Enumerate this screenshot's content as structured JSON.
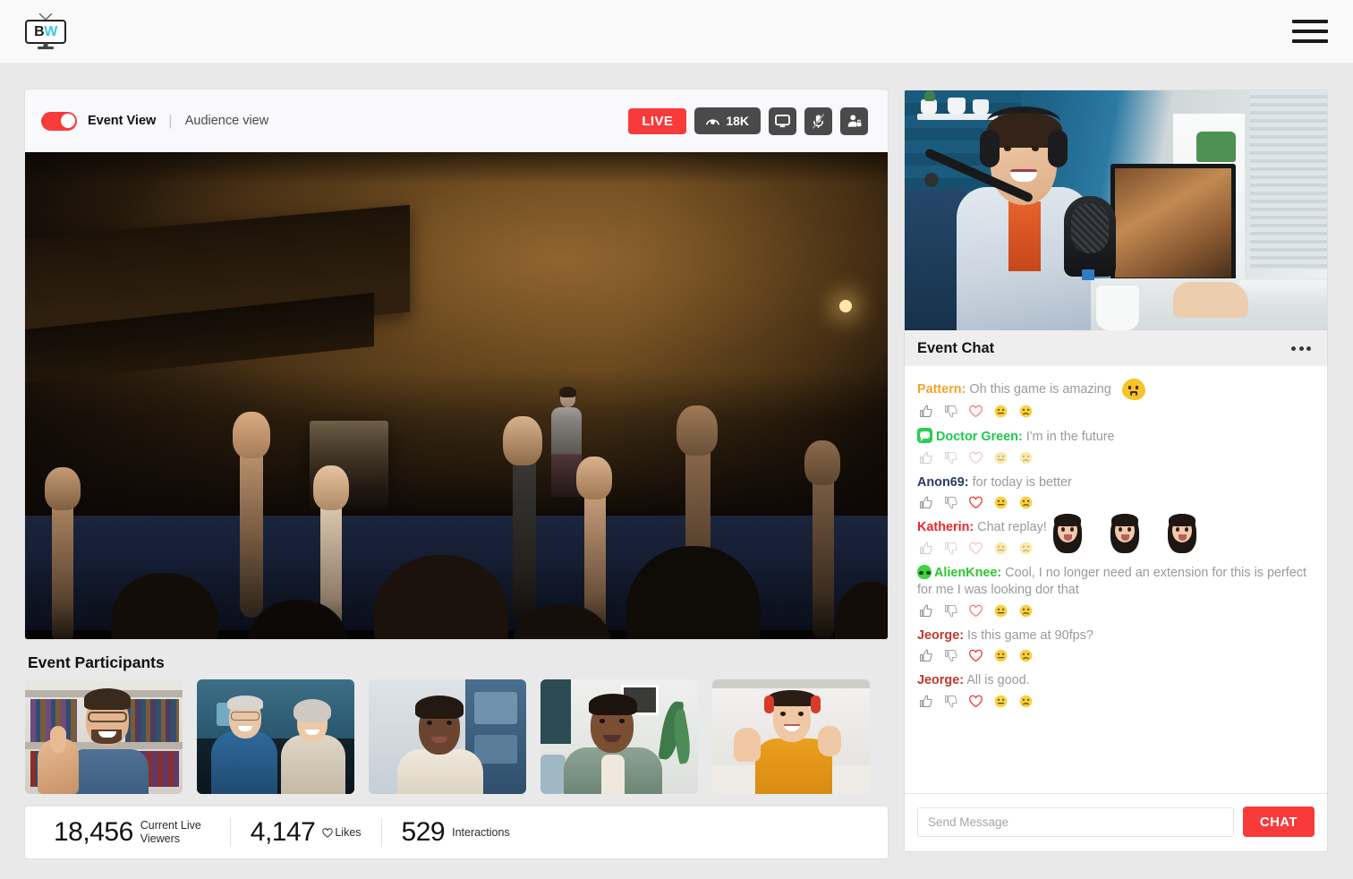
{
  "brand": {
    "logo_text_1": "B",
    "logo_text_2": "W",
    "logo_name": "BW"
  },
  "topbar": {
    "menu_label": "Menu"
  },
  "event_header": {
    "toggle_state": "on",
    "primary_label": "Event View",
    "separator": "|",
    "secondary_label": "Audience view",
    "live_label": "LIVE",
    "viewer_count": "18K",
    "viewer_icon": "eye-icon",
    "screen_icon": "monitor-icon",
    "mic_icon": "mic-muted-icon",
    "privacy_icon": "user-lock-icon"
  },
  "participants": {
    "title": "Event Participants",
    "items": [
      {
        "name": "participant-1",
        "desc": "Man with glasses giving thumbs up"
      },
      {
        "name": "participant-2",
        "desc": "Older couple smiling"
      },
      {
        "name": "participant-3",
        "desc": "Woman in cream top"
      },
      {
        "name": "participant-4",
        "desc": "Man in green shirt"
      },
      {
        "name": "participant-5",
        "desc": "Woman in orange top waving"
      }
    ]
  },
  "stats": [
    {
      "value": "18,456",
      "label": "Current Live Viewers",
      "icon": ""
    },
    {
      "value": "4,147",
      "label": "Likes",
      "icon": "heart-icon"
    },
    {
      "value": "529",
      "label": "Interactions",
      "icon": ""
    }
  ],
  "chat": {
    "title": "Event Chat",
    "menu_icon": "more-options-icon",
    "input_placeholder": "Send Message",
    "input_value": "",
    "send_label": "CHAT",
    "reaction_icons": [
      "thumbs-up-icon",
      "thumbs-down-icon",
      "heart-icon",
      "smiley-icon",
      "frowny-icon"
    ],
    "messages": [
      {
        "user": "Pattern:",
        "color": "#f5a32a",
        "text": " Oh this game is amazing",
        "badge": "none",
        "emoji": "blob",
        "emoji_count": 1,
        "faded": false
      },
      {
        "user": "Doctor Green:",
        "color": "#1fc94e",
        "text": " I'm in the future",
        "badge": "green-chat",
        "emoji": "none",
        "emoji_count": 0,
        "faded": true
      },
      {
        "user": "Anon69:",
        "color": "#2b3a6b",
        "text": " for today is better",
        "badge": "none",
        "emoji": "none",
        "emoji_count": 0,
        "faded": false
      },
      {
        "user": "Katherin:",
        "color": "#f02626",
        "text": " Chat replay!",
        "badge": "none",
        "emoji": "girl",
        "emoji_count": 3,
        "faded": true
      },
      {
        "user": "AlienKnee:",
        "color": "#2ec62e",
        "text": " Cool, I no longer need an extension for this is perfect  for me I was looking dor that",
        "badge": "alien",
        "emoji": "none",
        "emoji_count": 0,
        "faded": false
      },
      {
        "user": "Jeorge:",
        "color": "#c0392b",
        "text": " Is this game at 90fps?",
        "badge": "none",
        "emoji": "none",
        "emoji_count": 0,
        "faded": false
      },
      {
        "user": "Jeorge:",
        "color": "#c0392b",
        "text": " All is good.",
        "badge": "none",
        "emoji": "none",
        "emoji_count": 0,
        "faded": false
      }
    ]
  },
  "colors": {
    "accent_red": "#f93a3a",
    "page_bg": "#e9e9e9",
    "topbar_bg": "#f9f9f9",
    "card_header_bg": "#f9f8fc",
    "chat_header_bg": "#eeeeee",
    "logo_cyan": "#3fc5f0"
  },
  "video": {
    "main_desc": "Audience raising hands in auditorium",
    "host_desc": "Woman podcaster with headphones and microphone"
  }
}
